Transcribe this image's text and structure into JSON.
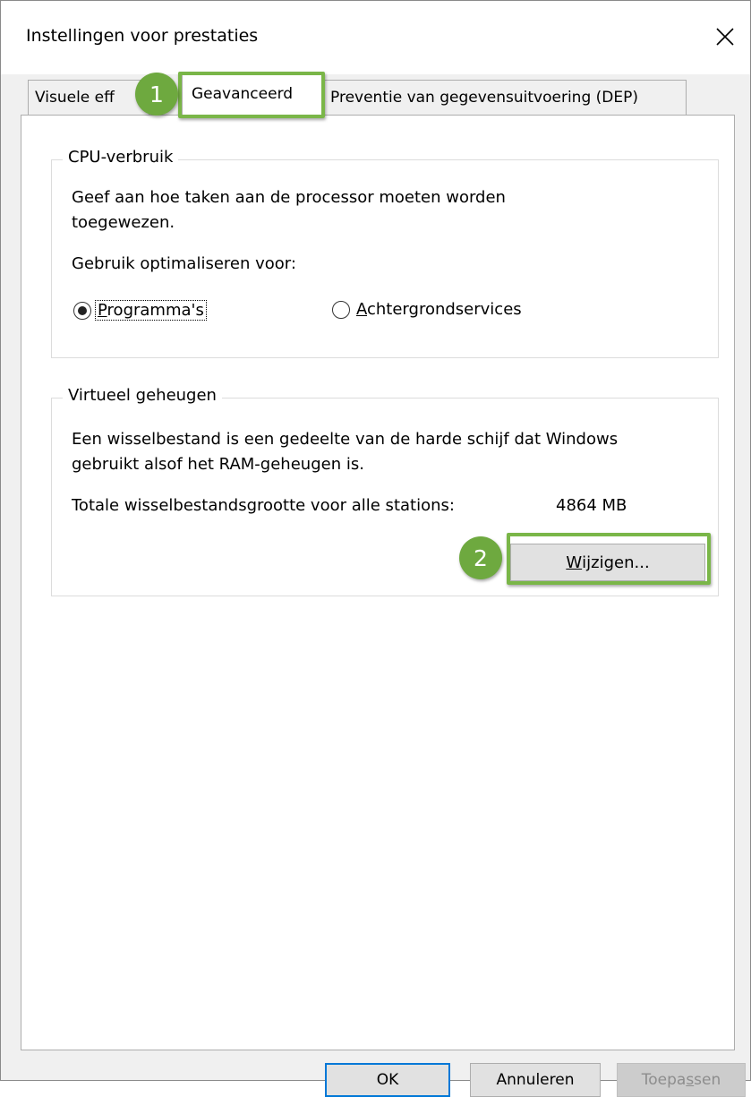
{
  "window": {
    "title": "Instellingen voor prestaties"
  },
  "tabs": [
    {
      "label": "Visuele eff",
      "active": false
    },
    {
      "label": "Geavanceerd",
      "active": true
    },
    {
      "label": "Preventie van gegevensuitvoering (DEP)",
      "active": false
    }
  ],
  "annotations": {
    "step1": "1",
    "step2": "2",
    "highlight_color": "#7ab648"
  },
  "cpu": {
    "legend": "CPU-verbruik",
    "description_line1": "Geef aan hoe taken aan de processor moeten worden",
    "description_line2": "toegewezen.",
    "optimize_label": "Gebruik optimaliseren voor:",
    "options": [
      {
        "accel": "P",
        "rest": "rogramma's",
        "selected": true
      },
      {
        "accel": "A",
        "rest": "chtergrondservices",
        "selected": false
      }
    ]
  },
  "virtual_memory": {
    "legend": "Virtueel geheugen",
    "description_line1": "Een wisselbestand is een gedeelte van de harde schijf dat Windows",
    "description_line2": "gebruikt alsof het RAM-geheugen is.",
    "total_label": "Totale wisselbestandsgrootte voor alle stations:",
    "total_value": "4864 MB",
    "change_button_accel": "W",
    "change_button_rest": "ijzigen..."
  },
  "footer": {
    "ok_label": "OK",
    "cancel_label": "Annuleren",
    "apply_label_pre": "Toepa",
    "apply_label_accel": "s",
    "apply_label_post": "sen"
  },
  "colors": {
    "accent": "#0078d7",
    "badge": "#6ea93f"
  }
}
